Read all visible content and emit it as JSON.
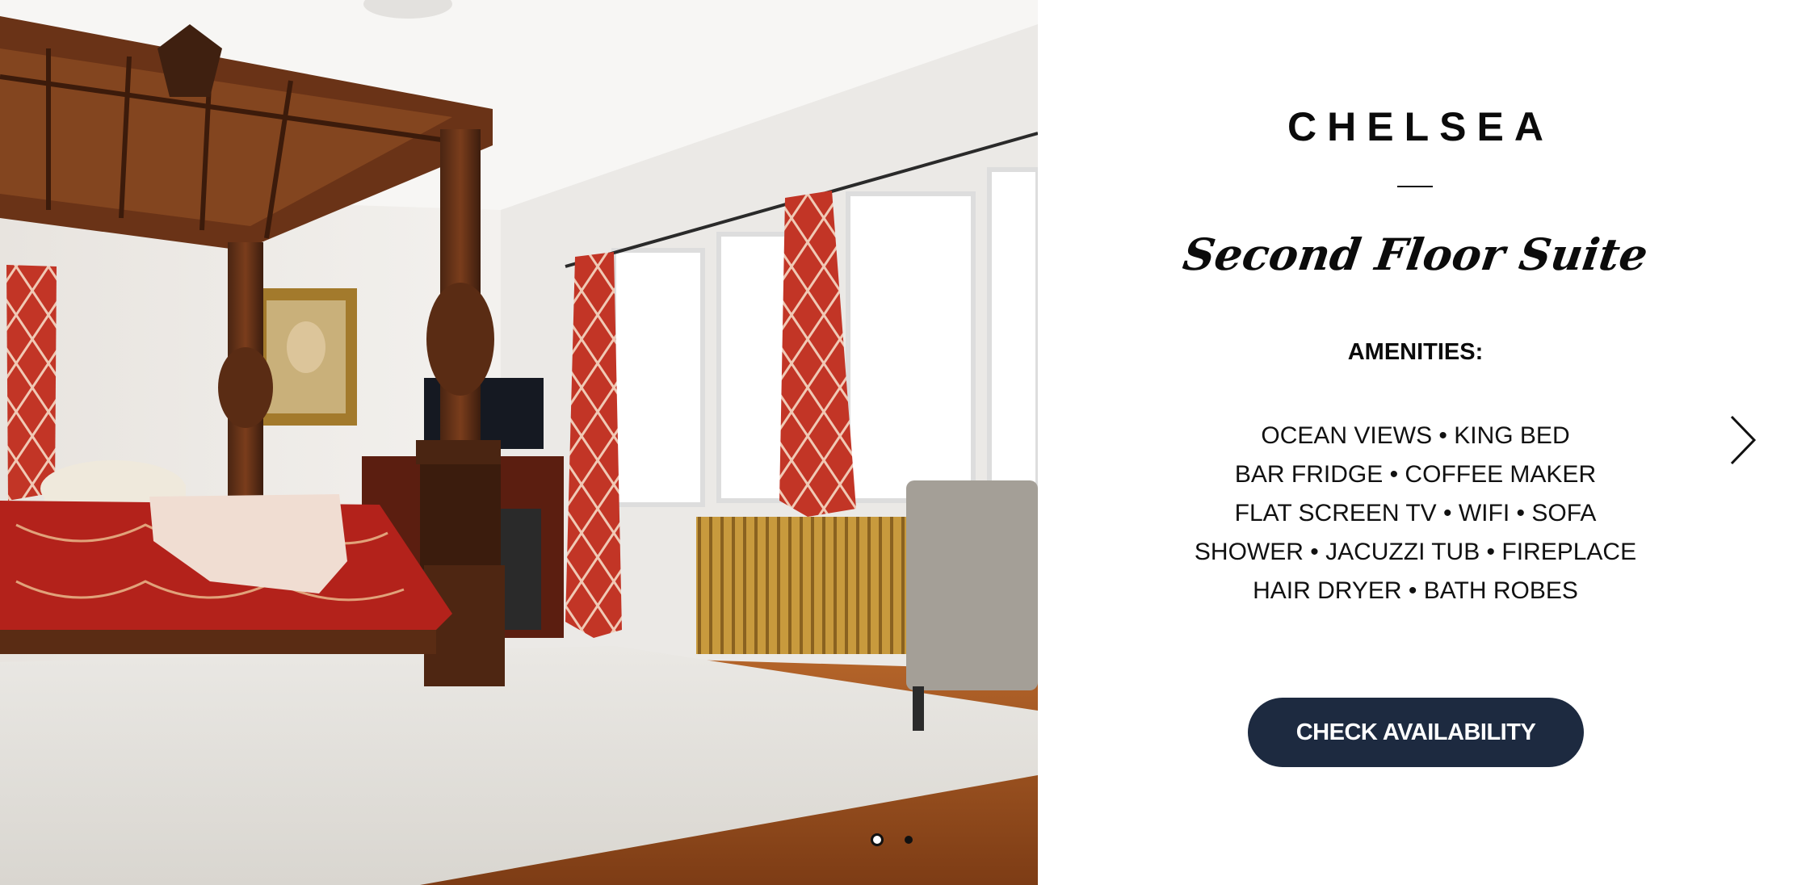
{
  "room": {
    "name": "CHELSEA",
    "subtitle": "Second Floor Suite",
    "amenities_label": "AMENITIES:",
    "amenities_lines": [
      "OCEAN VIEWS • KING BED",
      "BAR FRIDGE • COFFEE MAKER",
      "FLAT SCREEN TV • WIFI • SOFA",
      "SHOWER • JACUZZI TUB • FIREPLACE",
      "HAIR DRYER • BATH ROBES"
    ],
    "cta_label": "CHECK AVAILABILITY"
  },
  "slider": {
    "slide_count": 2,
    "active_slide": 1,
    "next_icon": "chevron-right-icon"
  },
  "colors": {
    "cta_background": "#1d2a40",
    "cta_text": "#ffffff",
    "text": "#0b0b0b"
  }
}
